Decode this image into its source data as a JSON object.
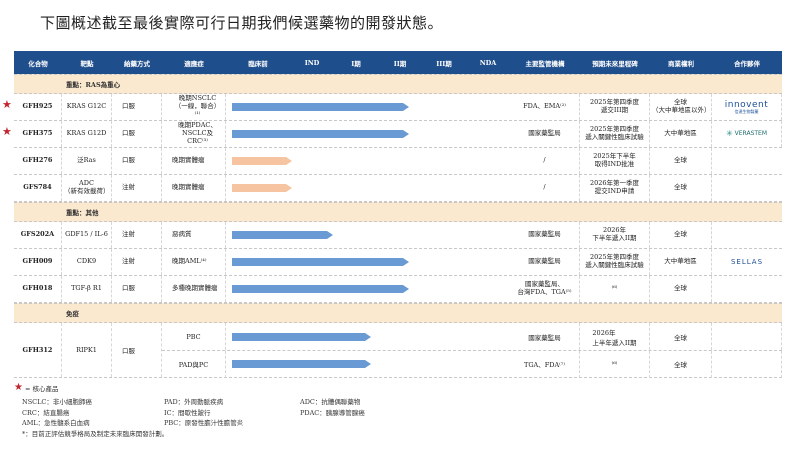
{
  "title": "下圖概述截至最後實際可行日期我們候選藥物的開發狀態。",
  "header": [
    "化合物",
    "靶點",
    "給藥方式",
    "適應症",
    "臨床前",
    "IND",
    "I期",
    "II期",
    "III期",
    "NDA",
    "主要監管機構",
    "預期未來里程碑",
    "商業權利",
    "合作夥伴"
  ],
  "sections": {
    "ras": "重點：RAS為重心",
    "other": "重點：其他",
    "immune": "免疫"
  },
  "rows_ras": [
    {
      "star": true,
      "compound": "GFH925",
      "target": "KRAS G12C",
      "route": "口服",
      "indication": "晚期NSCLC\n（一線，聯合）⁽¹⁾",
      "bar": 0.63,
      "color": "blue",
      "regulator": "FDA、EMA⁽²⁾",
      "milestone": "2025年第四季度\n遞交III期",
      "rights": "全球\n（大中華地區以外）",
      "partner": "innovent"
    },
    {
      "star": true,
      "compound": "GFH375",
      "target": "KRAS G12D",
      "route": "口服",
      "indication": "晚期PDAC、\nNSCLC及CRC⁽³⁾",
      "bar": 0.63,
      "color": "blue",
      "regulator": "國家藥監局",
      "milestone": "2025年第四季度\n遞入關鍵性臨床試驗",
      "rights": "大中華地區",
      "partner": "verastem"
    },
    {
      "star": false,
      "compound": "GFH276",
      "target": "泛Ras",
      "route": "口服",
      "indication": "晚期實體瘤",
      "bar": 0.2,
      "color": "orange",
      "regulator": "/",
      "milestone": "2025年下半年\n取得IND批准",
      "rights": "全球",
      "partner": ""
    },
    {
      "star": false,
      "compound": "GFS784",
      "target": "ADC\n（新有效載荷）",
      "route": "注射",
      "indication": "晚期實體瘤",
      "bar": 0.2,
      "color": "orange",
      "regulator": "/",
      "milestone": "2026年第一季度\n提交IND申請",
      "rights": "全球",
      "partner": ""
    }
  ],
  "rows_other": [
    {
      "star": false,
      "compound": "GFS202A",
      "target": "GDF15 / IL-6",
      "route": "注射",
      "indication": "惡病質",
      "bar": 0.35,
      "color": "blue",
      "regulator": "國家藥監局",
      "milestone": "2026年\n下半年遞入II期",
      "rights": "全球",
      "partner": ""
    },
    {
      "star": false,
      "compound": "GFH009",
      "target": "CDK9",
      "route": "注射",
      "indication": "晚期AML⁽⁴⁾",
      "bar": 0.63,
      "color": "blue",
      "regulator": "國家藥監局",
      "milestone": "2025年第四季度\n遞入關鍵性臨床試驗",
      "rights": "大中華地區",
      "partner": "sellas"
    },
    {
      "star": false,
      "compound": "GFH018",
      "target": "TGF-β R1",
      "route": "口服",
      "indication": "多種晚期實體瘤",
      "bar": 0.63,
      "color": "blue",
      "regulator": "國家藥監局、\n台灣FDA、TGA⁽⁵⁾",
      "milestone": "⁽⁶⁾",
      "rights": "全球",
      "partner": ""
    }
  ],
  "gfh312": {
    "compound": "GFH312",
    "target": "RIPK1",
    "route": "口服",
    "subrows": [
      {
        "indication": "PBC",
        "bar": 0.49,
        "color": "blue",
        "regulator": "國家藥監局",
        "milestone": "2026年\n上半年遞入II期",
        "rights": "全球"
      },
      {
        "indication": "PAD與PC",
        "bar": 0.49,
        "color": "blue",
        "regulator": "TGA、FDA⁽⁷⁾",
        "milestone": "⁽⁶⁾",
        "rights": "全球"
      }
    ]
  },
  "partners": {
    "innovent": {
      "name": "innovent",
      "sub": "信達生物製藥"
    },
    "verastem": {
      "name": "VERASTEM",
      "sub": "ONCOLOGY"
    },
    "sellas": {
      "name": "SELLAS"
    }
  },
  "legend": {
    "star": "= 核心產品",
    "col1": [
      "NSCLC：非小細胞肺癌",
      "CRC：結直腸癌",
      "AML：急性髓系白血病"
    ],
    "col2": [
      "PAD：外周動脈疾病",
      "IC：間歇性跛行",
      "PBC：原發性膽汁性膽管炎"
    ],
    "col3": [
      "ADC：抗體偶聯藥物",
      "PDAC：胰腺導管腺癌"
    ],
    "note": "*：目前正評估競爭格局及制定未來臨床開發計劃。"
  },
  "colors": {
    "header": "#1f4e8c",
    "section": "#fbe9cf",
    "bar_blue": "#6a9ad3",
    "bar_orange": "#f6c4a0",
    "star": "#c0272d"
  }
}
